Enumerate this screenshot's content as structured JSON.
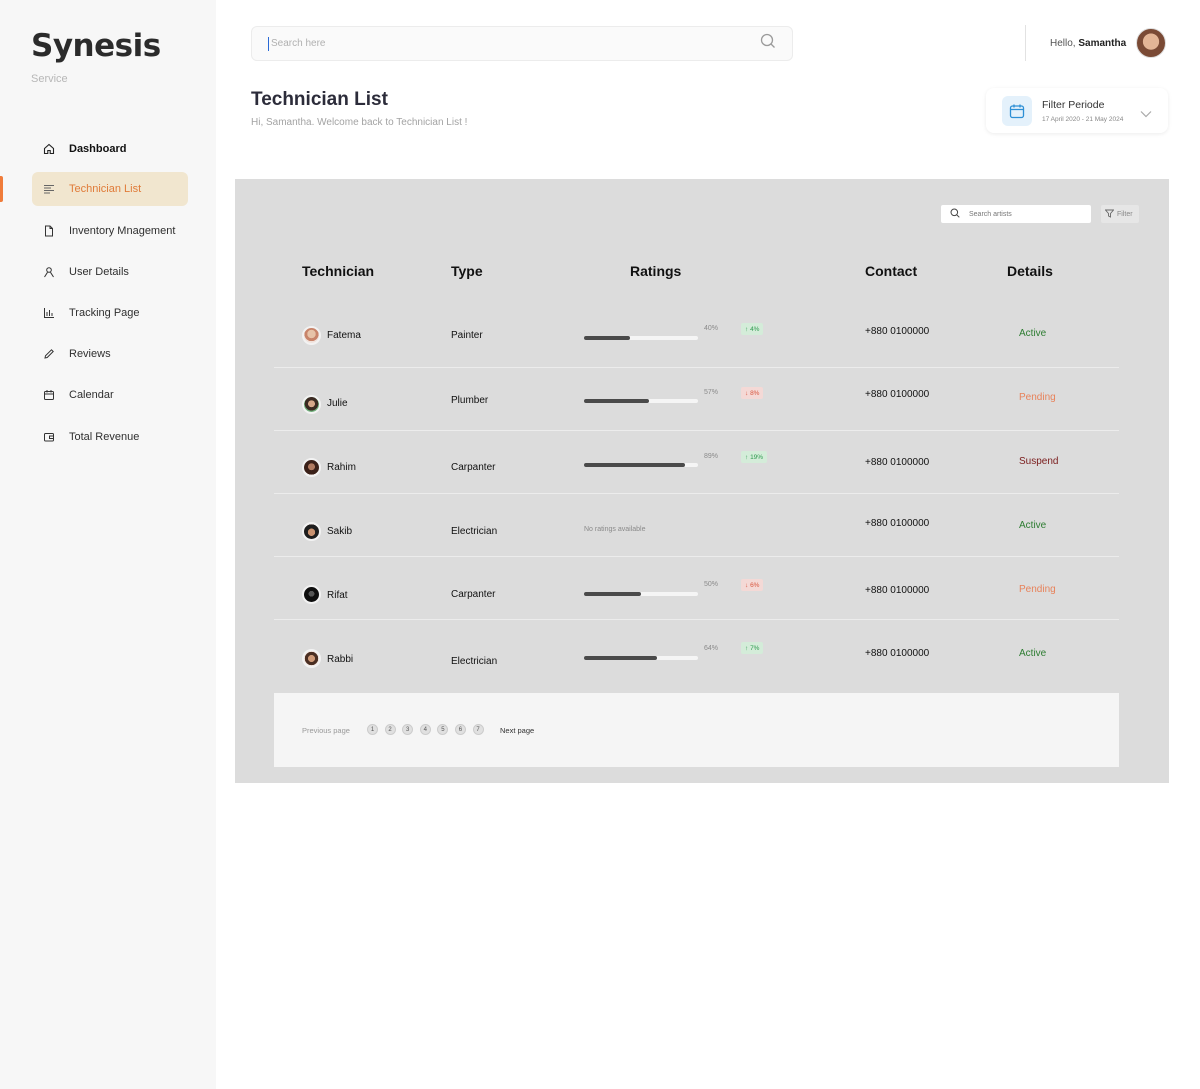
{
  "brand": {
    "name": "Synesis",
    "subtitle": "Service"
  },
  "sidebar": {
    "items": [
      {
        "label": "Dashboard",
        "icon": "home-icon"
      },
      {
        "label": "Technician List",
        "icon": "list-icon"
      },
      {
        "label": "Inventory Mnagement",
        "icon": "file-icon"
      },
      {
        "label": "User Details",
        "icon": "user-icon"
      },
      {
        "label": "Tracking Page",
        "icon": "bar-chart-icon"
      },
      {
        "label": "Reviews",
        "icon": "pencil-icon"
      },
      {
        "label": "Calendar",
        "icon": "calendar-icon"
      },
      {
        "label": "Total Revenue",
        "icon": "wallet-icon"
      }
    ]
  },
  "header": {
    "search_placeholder": "Search here",
    "greeting": "Hello,",
    "user_name": "Samantha"
  },
  "page": {
    "title": "Technician List",
    "subtitle": "Hi, Samantha. Welcome back  to  Technician List !"
  },
  "filter": {
    "title": "Filter Periode",
    "range": "17 April 2020 - 21 May 2024"
  },
  "table": {
    "search_placeholder": "Search artists",
    "filter_label": "Filter",
    "headers": [
      "Technician",
      "Type",
      "Ratings",
      "Contact",
      "Details"
    ],
    "rows": [
      {
        "name": "Fatema",
        "type": "Painter",
        "rating": 0.4,
        "rating_label": "40%",
        "change": "4%",
        "change_dir": "up",
        "contact": "+880 0100000",
        "status": "Active",
        "status_color": "#2e7d32"
      },
      {
        "name": "Julie",
        "type": "Plumber",
        "rating": 0.57,
        "rating_label": "57%",
        "change": "8%",
        "change_dir": "down",
        "contact": "+880 0100000",
        "status": "Pending",
        "status_color": "#e8825a"
      },
      {
        "name": "Rahim",
        "type": "Carpanter",
        "rating": 0.89,
        "rating_label": "89%",
        "change": "19%",
        "change_dir": "up",
        "contact": "+880 0100000",
        "status": "Suspend",
        "status_color": "#7a1c1c"
      },
      {
        "name": "Sakib",
        "type": "Electrician",
        "rating": null,
        "no_rating_text": "No ratings available",
        "contact": "+880 0100000",
        "status": "Active",
        "status_color": "#2e7d32"
      },
      {
        "name": "Rifat",
        "type": "Carpanter",
        "rating": 0.5,
        "rating_label": "50%",
        "change": "6%",
        "change_dir": "down",
        "contact": "+880 0100000",
        "status": "Pending",
        "status_color": "#e8825a"
      },
      {
        "name": "Rabbi",
        "type": "Electrician",
        "rating": 0.64,
        "rating_label": "64%",
        "change": "7%",
        "change_dir": "up",
        "contact": "+880 0100000",
        "status": "Active",
        "status_color": "#2e7d32"
      }
    ]
  },
  "pagination": {
    "prev_label": "Previous page",
    "pages": [
      "1",
      "2",
      "3",
      "4",
      "5",
      "6",
      "7"
    ],
    "next_label": "Next page"
  },
  "colors": {
    "accent": "#f07c3a",
    "active_bg": "#f1e6cf",
    "panel_bg": "#dcdcdc"
  }
}
